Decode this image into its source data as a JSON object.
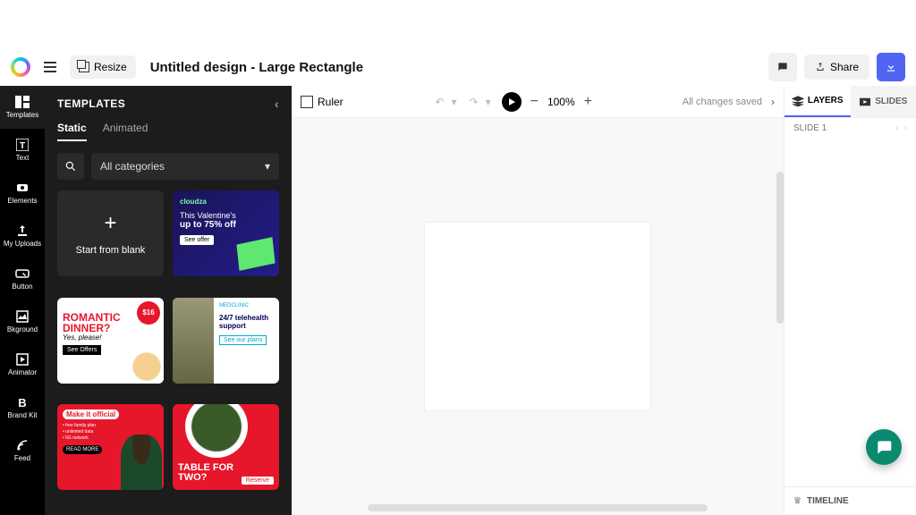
{
  "header": {
    "resize_label": "Resize",
    "title": "Untitled design - Large Rectangle",
    "share_label": "Share"
  },
  "nav": {
    "items": [
      {
        "label": "Templates"
      },
      {
        "label": "Text"
      },
      {
        "label": "Elements"
      },
      {
        "label": "My Uploads"
      },
      {
        "label": "Button"
      },
      {
        "label": "Bkground"
      },
      {
        "label": "Animator"
      },
      {
        "label": "Brand Kit"
      },
      {
        "label": "Feed"
      }
    ]
  },
  "panel": {
    "title": "TEMPLATES",
    "tabs": {
      "static": "Static",
      "animated": "Animated"
    },
    "category_label": "All categories",
    "blank_label": "Start from blank",
    "templates": {
      "cloudza": {
        "brand": "cloudza",
        "line1": "This Valentine's",
        "line2": "up to 75% off",
        "cta": "See offer"
      },
      "romantic": {
        "price": "$16",
        "line1": "ROMANTIC",
        "line2": "DINNER?",
        "tag": "Yes, please!",
        "cta": "See Offers"
      },
      "telehealth": {
        "brand": "MEDCLINIC",
        "line1": "24/7 telehealth",
        "line2": "support",
        "cta": "See our plans"
      },
      "makeofficial": {
        "line1": "Make it",
        "line2": "official",
        "cta": "READ MORE"
      },
      "tablefortwo": {
        "line1": "TABLE FOR",
        "line2": "TWO?",
        "cta": "Reserve"
      }
    }
  },
  "toolbar": {
    "ruler_label": "Ruler",
    "zoom_level": "100%",
    "status": "All changes saved"
  },
  "right": {
    "tab_layers": "LAYERS",
    "tab_slides": "SLIDES",
    "slide_label": "SLIDE 1",
    "timeline_label": "TIMELINE"
  }
}
